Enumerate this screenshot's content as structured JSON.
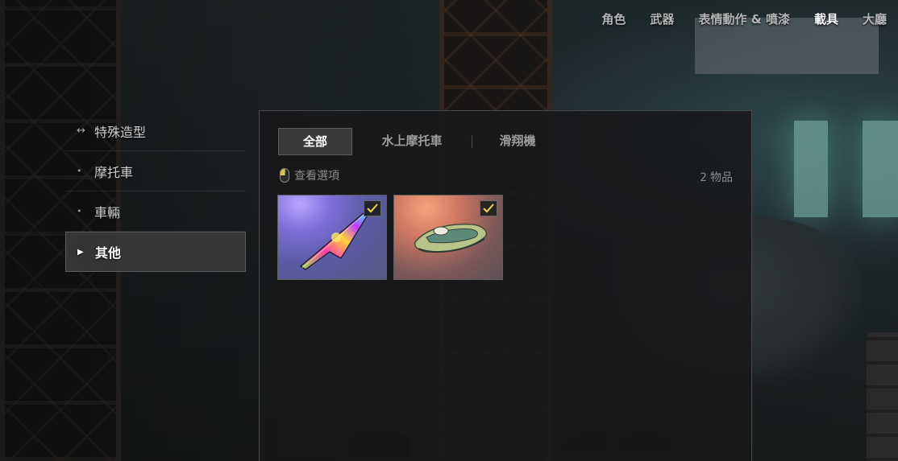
{
  "colors": {
    "accent_check": "#e8d64a",
    "active_text": "#ffffff",
    "inactive_text": "#b5b5b5",
    "panel_bg": "#18181a"
  },
  "topnav": {
    "items": [
      {
        "label": "角色",
        "active": false
      },
      {
        "label": "武器",
        "active": false
      },
      {
        "label": "表情動作 & 噴漆",
        "active": false
      },
      {
        "label": "載具",
        "active": true
      },
      {
        "label": "大廳",
        "active": false
      }
    ]
  },
  "categories": {
    "items": [
      {
        "label": "特殊造型",
        "icon": "arrows-horizontal-icon",
        "active": false
      },
      {
        "label": "摩托車",
        "icon": "dot-icon",
        "active": false
      },
      {
        "label": "車輛",
        "icon": "dot-icon",
        "active": false
      },
      {
        "label": "其他",
        "icon": "triangle-right-icon",
        "active": true
      }
    ]
  },
  "panel": {
    "tabs": [
      {
        "label": "全部",
        "active": true
      },
      {
        "label": "水上摩托車",
        "active": false
      },
      {
        "label": "滑翔機",
        "active": false
      }
    ],
    "options_label": "查看選項",
    "count_number": "2",
    "count_unit": "物品",
    "items": [
      {
        "name": "glider-skin",
        "icon": "glider-icon",
        "equipped": true
      },
      {
        "name": "jetski-skin",
        "icon": "jetski-icon",
        "equipped": true
      }
    ]
  }
}
